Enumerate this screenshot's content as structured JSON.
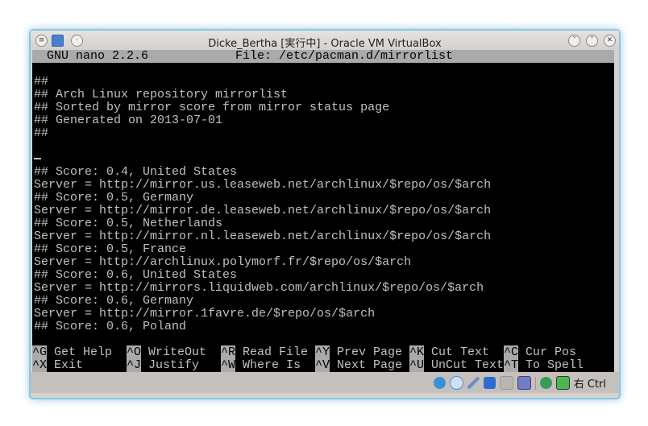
{
  "window": {
    "title": "Dicke_Bertha [実行中] - Oracle VM VirtualBox"
  },
  "nano": {
    "version": "GNU nano 2.2.6",
    "file": "File: /etc/pacman.d/mirrorlist",
    "lines": [
      "",
      "##",
      "## Arch Linux repository mirrorlist",
      "## Sorted by mirror score from mirror status page",
      "## Generated on 2013-07-01",
      "##",
      "",
      "",
      "## Score: 0.4, United States",
      "Server = http://mirror.us.leaseweb.net/archlinux/$repo/os/$arch",
      "## Score: 0.5, Germany",
      "Server = http://mirror.de.leaseweb.net/archlinux/$repo/os/$arch",
      "## Score: 0.5, Netherlands",
      "Server = http://mirror.nl.leaseweb.net/archlinux/$repo/os/$arch",
      "## Score: 0.5, France",
      "Server = http://archlinux.polymorf.fr/$repo/os/$arch",
      "## Score: 0.6, United States",
      "Server = http://mirrors.liquidweb.com/archlinux/$repo/os/$arch",
      "## Score: 0.6, Germany",
      "Server = http://mirror.1favre.de/$repo/os/$arch",
      "## Score: 0.6, Poland",
      ""
    ],
    "shortcuts": [
      [
        {
          "key": "^G",
          "label": "Get Help"
        },
        {
          "key": "^O",
          "label": "WriteOut"
        },
        {
          "key": "^R",
          "label": "Read File"
        },
        {
          "key": "^Y",
          "label": "Prev Page"
        },
        {
          "key": "^K",
          "label": "Cut Text"
        },
        {
          "key": "^C",
          "label": "Cur Pos"
        }
      ],
      [
        {
          "key": "^X",
          "label": "Exit"
        },
        {
          "key": "^J",
          "label": "Justify"
        },
        {
          "key": "^W",
          "label": "Where Is"
        },
        {
          "key": "^V",
          "label": "Next Page"
        },
        {
          "key": "^U",
          "label": "UnCut Text"
        },
        {
          "key": "^T",
          "label": "To Spell"
        }
      ]
    ]
  },
  "statusbar": {
    "host_key": "右 Ctrl",
    "icons": [
      "hard-disk-icon",
      "optical-disk-icon",
      "usb-icon",
      "network-icon",
      "shared-folder-icon",
      "video-capture-icon",
      "virtualization-icon",
      "mouse-integration-icon"
    ]
  }
}
